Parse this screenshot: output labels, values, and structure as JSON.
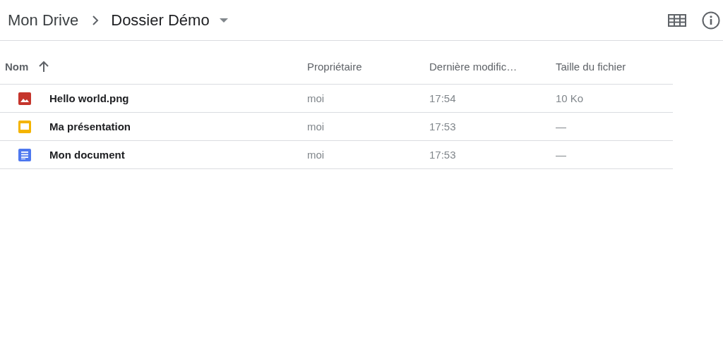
{
  "breadcrumb": [
    {
      "label": "Mon Drive",
      "current": false
    },
    {
      "label": "Dossier Démo",
      "current": true
    }
  ],
  "table": {
    "columns": [
      {
        "label": "Nom",
        "sorted": true
      },
      {
        "label": "Propriétaire",
        "sorted": false
      },
      {
        "label": "Dernière modific…",
        "sorted": false
      },
      {
        "label": "Taille du fichier",
        "sorted": false
      }
    ],
    "rows": [
      {
        "kind": "image",
        "name": "Hello world.png",
        "owner": "moi",
        "modified": "17:54",
        "size": "10 Ko"
      },
      {
        "kind": "slides",
        "name": "Ma présentation",
        "owner": "moi",
        "modified": "17:53",
        "size": "—"
      },
      {
        "kind": "doc",
        "name": "Mon document",
        "owner": "moi",
        "modified": "17:53",
        "size": "—"
      }
    ]
  }
}
